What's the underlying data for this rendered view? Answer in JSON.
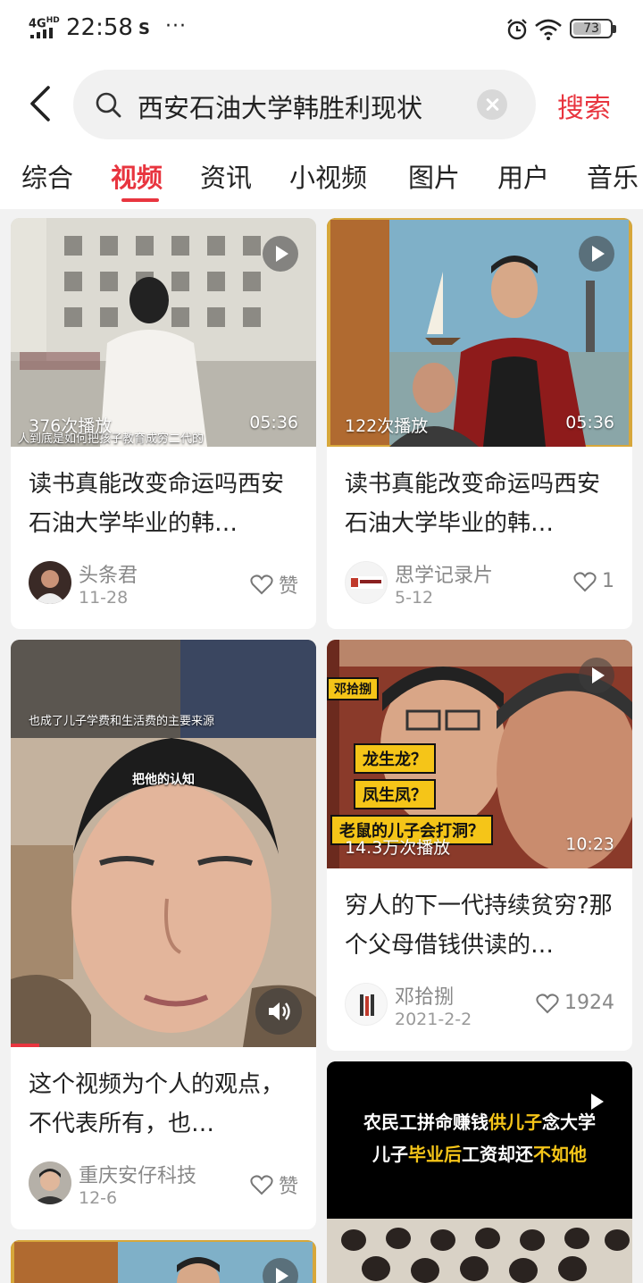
{
  "status_bar": {
    "network": "4G",
    "network_sup": "HD",
    "time": "22:58",
    "extra_icon": "S",
    "more": "···",
    "battery": "73"
  },
  "search": {
    "query": "西安石油大学韩胜利现状",
    "button": "搜索"
  },
  "tabs": [
    {
      "label": "综合",
      "active": false
    },
    {
      "label": "视频",
      "active": true
    },
    {
      "label": "资讯",
      "active": false
    },
    {
      "label": "小视频",
      "active": false
    },
    {
      "label": "图片",
      "active": false
    },
    {
      "label": "用户",
      "active": false
    },
    {
      "label": "音乐",
      "active": false
    }
  ],
  "cards": [
    {
      "views": "376次播放",
      "duration": "05:36",
      "caption": "人到底是如何把孩子教育成穷二代的",
      "title": "读书真能改变命运吗西安石油大学毕业的韩…",
      "author": "头条君",
      "date": "11-28",
      "likes": "赞"
    },
    {
      "views": "122次播放",
      "duration": "05:36",
      "title": "读书真能改变命运吗西安石油大学毕业的韩…",
      "author": "思学记录片",
      "date": "5-12",
      "likes": "1"
    },
    {
      "caption_top": "也成了儿子学费和生活费的主要来源",
      "caption_mid": "把他的认知",
      "title": "这个视频为个人的观点，不代表所有，也…",
      "author": "重庆安仔科技",
      "date": "12-6",
      "likes": "赞"
    },
    {
      "banner_tag": "邓拾捌",
      "tags": [
        "龙生龙？",
        "凤生凤？",
        "老鼠的儿子会打洞？"
      ],
      "views": "14.3万次播放",
      "duration": "10:23",
      "title": "穷人的下一代持续贫穷?那个父母借钱供读的…",
      "author": "邓拾捌",
      "date": "2021-2-2",
      "likes": "1924"
    },
    {
      "line1_a": "农民工拼命赚钱",
      "line1_b": "供儿子",
      "line1_c": "念大学",
      "line2_a": "儿子",
      "line2_b": "毕业后",
      "line2_c": "工资却还",
      "line2_d": "不如他"
    }
  ]
}
